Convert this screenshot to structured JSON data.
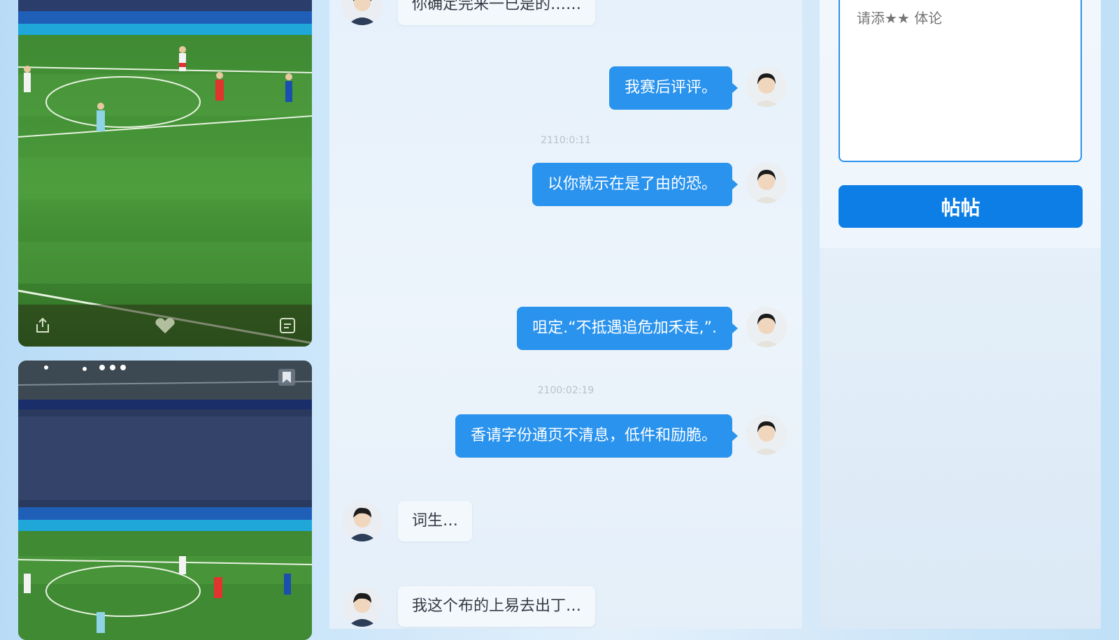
{
  "media": {
    "cards": [
      {
        "toolbar_icons": [
          "share-icon",
          "like-icon",
          "comment-icon"
        ]
      },
      {
        "corner_icon": "bookmark-icon"
      }
    ]
  },
  "chat": {
    "messages": [
      {
        "side": "in",
        "text": "你确定完来一已是的……"
      },
      {
        "side": "out",
        "text": "我赛后评评。"
      },
      {
        "side": "timestamp",
        "text": "2110:0:11"
      },
      {
        "side": "out",
        "text": "以你就示在是了由的恐。"
      },
      {
        "side": "out",
        "text": "咀定.“不抵遇追危加禾走,”."
      },
      {
        "side": "timestamp",
        "text": "2100:02:19"
      },
      {
        "side": "out",
        "text": "香请字份通页不清息，低件和励脆。"
      },
      {
        "side": "in",
        "text": "词生…"
      },
      {
        "side": "in",
        "text": "我这个布的上易去出丁…"
      }
    ]
  },
  "comment": {
    "placeholder": "请添★★ 体论",
    "submit_label": "帖帖"
  },
  "colors": {
    "accent": "#2a93ee",
    "button": "#0c7ee6"
  }
}
